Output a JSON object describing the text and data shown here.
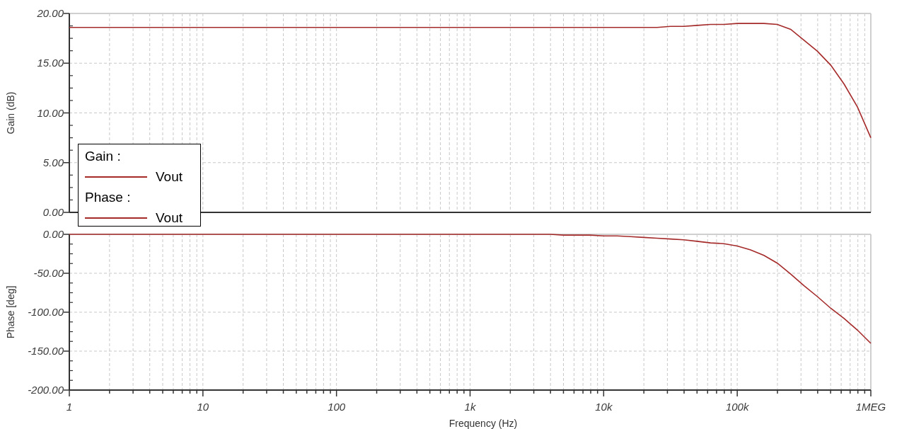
{
  "gain_plot": {
    "legend_heading": "Gain :",
    "chart_data": {
      "type": "line",
      "ylabel": "Gain (dB)",
      "grid": true,
      "ylim": [
        0,
        20
      ],
      "yticks": [
        {
          "value": 0,
          "label": "0.00"
        },
        {
          "value": 5,
          "label": "5.00"
        },
        {
          "value": 10,
          "label": "10.00"
        },
        {
          "value": 15,
          "label": "15.00"
        },
        {
          "value": 20,
          "label": "20.00"
        }
      ],
      "categories": [
        null,
        null,
        null,
        null,
        null,
        null,
        null,
        null,
        null,
        null,
        null,
        null,
        null,
        null,
        null,
        null,
        null,
        null,
        null,
        null,
        null,
        null,
        null,
        null,
        null,
        null,
        null,
        null,
        null,
        null,
        null,
        null,
        null,
        null,
        null,
        null,
        null,
        null,
        null,
        null,
        null,
        null,
        null,
        null,
        null,
        null,
        null,
        null,
        null,
        null,
        null,
        null,
        null,
        null,
        null,
        null,
        null,
        null,
        null,
        null,
        null
      ],
      "series": [
        {
          "name": "Vout",
          "color": "#a52a2a",
          "values": [
            18.6,
            18.6,
            18.6,
            18.6,
            18.6,
            18.6,
            18.6,
            18.6,
            18.6,
            18.6,
            18.6,
            18.6,
            18.6,
            18.6,
            18.6,
            18.6,
            18.6,
            18.6,
            18.6,
            18.6,
            18.6,
            18.6,
            18.6,
            18.6,
            18.6,
            18.6,
            18.6,
            18.6,
            18.6,
            18.6,
            18.6,
            18.6,
            18.6,
            18.6,
            18.6,
            18.6,
            18.6,
            18.6,
            18.6,
            18.6,
            18.6,
            18.6,
            18.6,
            18.6,
            18.6,
            18.7,
            18.7,
            18.8,
            18.9,
            18.9,
            19.0,
            19.0,
            19.0,
            18.9,
            18.4,
            17.3,
            16.2,
            14.8,
            12.9,
            10.6,
            7.5
          ]
        }
      ]
    }
  },
  "phase_plot": {
    "legend_heading": "Phase :",
    "chart_data": {
      "type": "line",
      "xlabel": "Frequency (Hz)",
      "ylabel": "Phase [deg]",
      "grid": true,
      "ylim": [
        -200,
        0
      ],
      "yticks": [
        {
          "value": -200,
          "label": "-200.00"
        },
        {
          "value": -150,
          "label": "-150.00"
        },
        {
          "value": -100,
          "label": "-100.00"
        },
        {
          "value": -50,
          "label": "-50.00"
        },
        {
          "value": 0,
          "label": "0.00"
        }
      ],
      "categories": [
        "1",
        null,
        null,
        null,
        null,
        null,
        null,
        null,
        null,
        null,
        "10",
        null,
        null,
        null,
        null,
        null,
        null,
        null,
        null,
        null,
        "100",
        null,
        null,
        null,
        null,
        null,
        null,
        null,
        null,
        null,
        "1k",
        null,
        null,
        null,
        null,
        null,
        null,
        null,
        null,
        null,
        "10k",
        null,
        null,
        null,
        null,
        null,
        null,
        null,
        null,
        null,
        "100k",
        null,
        null,
        null,
        null,
        null,
        null,
        null,
        null,
        null,
        "1MEG"
      ],
      "series": [
        {
          "name": "Vout",
          "color": "#a52a2a",
          "values": [
            0,
            0,
            0,
            0,
            0,
            0,
            0,
            0,
            0,
            0,
            0,
            0,
            0,
            0,
            0,
            0,
            0,
            0,
            0,
            0,
            0,
            0,
            0,
            0,
            0,
            0,
            0,
            0,
            0,
            0,
            0,
            0,
            0,
            0,
            0,
            0,
            0,
            -1,
            -1,
            -1,
            -2,
            -2,
            -3,
            -4,
            -5,
            -6,
            -7,
            -9,
            -11,
            -12,
            -15,
            -20,
            -27,
            -37,
            -51,
            -66,
            -80,
            -95,
            -108,
            -123,
            -140
          ]
        }
      ]
    }
  }
}
